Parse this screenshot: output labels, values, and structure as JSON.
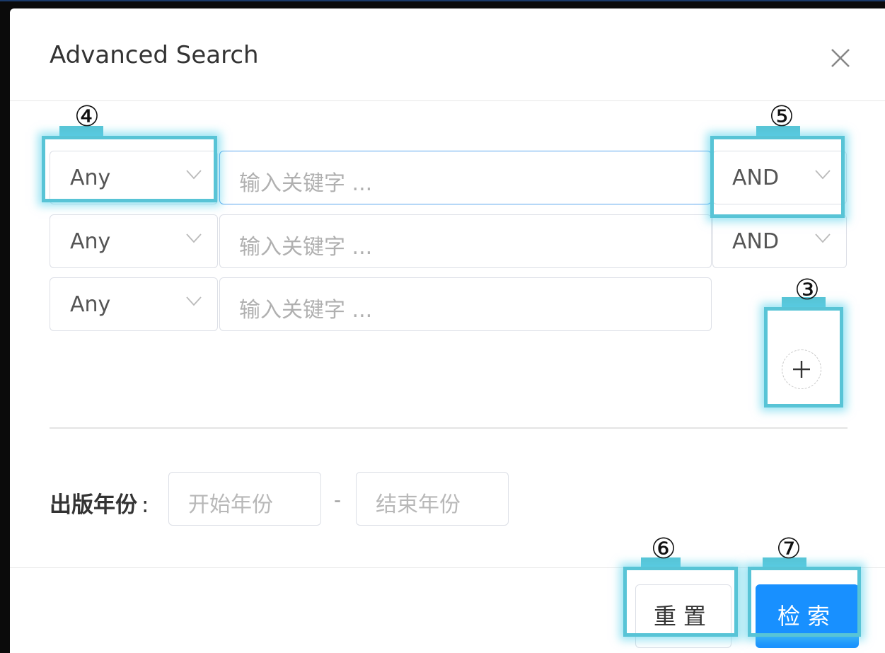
{
  "dialog": {
    "title": "Advanced Search",
    "close_icon": "close-icon"
  },
  "rows": [
    {
      "field": "Any",
      "placeholder": "输入关键字 ...",
      "operator": "AND"
    },
    {
      "field": "Any",
      "placeholder": "输入关键字 ...",
      "operator": "AND"
    },
    {
      "field": "Any",
      "placeholder": "输入关键字 ..."
    }
  ],
  "add_row_icon": "plus-icon",
  "year": {
    "label": "出版年份",
    "colon": ":",
    "start_placeholder": "开始年份",
    "separator": "-",
    "end_placeholder": "结束年份"
  },
  "footer": {
    "reset_label": "重置",
    "search_label": "检索"
  },
  "annotations": {
    "add_button": "③",
    "field_select": "④",
    "operator_select": "⑤",
    "reset_button": "⑥",
    "search_button": "⑦"
  },
  "colors": {
    "primary": "#1890ff",
    "highlight": "#58c4d6"
  }
}
